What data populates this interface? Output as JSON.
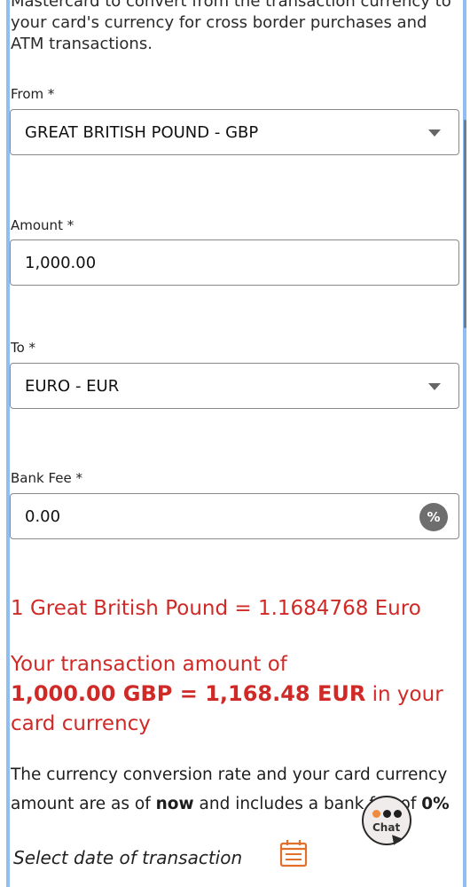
{
  "intro_text": "Mastercard to convert from the transaction currency to your card's currency for cross border purchases and ATM transactions.",
  "from": {
    "label": "From *",
    "value": "GREAT BRITISH POUND - GBP"
  },
  "amount": {
    "label": "Amount *",
    "value": "1,000.00"
  },
  "to": {
    "label": "To *",
    "value": "EURO - EUR"
  },
  "bank_fee": {
    "label": "Bank Fee *",
    "value": "0.00",
    "icon_symbol": "%"
  },
  "rate_line": "1 Great British Pound = 1.1684768 Euro",
  "result": {
    "prefix": "Your transaction amount of",
    "amount_bold": "1,000.00 GBP = 1,168.48 EUR",
    "suffix": " in your card currency"
  },
  "note": {
    "part1": "The currency conversion rate and your card currency amount are as of ",
    "now": "now",
    "part2": " and includes a bank fee of ",
    "fee": "0%"
  },
  "date_label": "Select date of transaction",
  "chat": {
    "label": "Chat"
  },
  "colors": {
    "accent_red": "#cf2a27",
    "calendar_orange": "#e0702a"
  }
}
